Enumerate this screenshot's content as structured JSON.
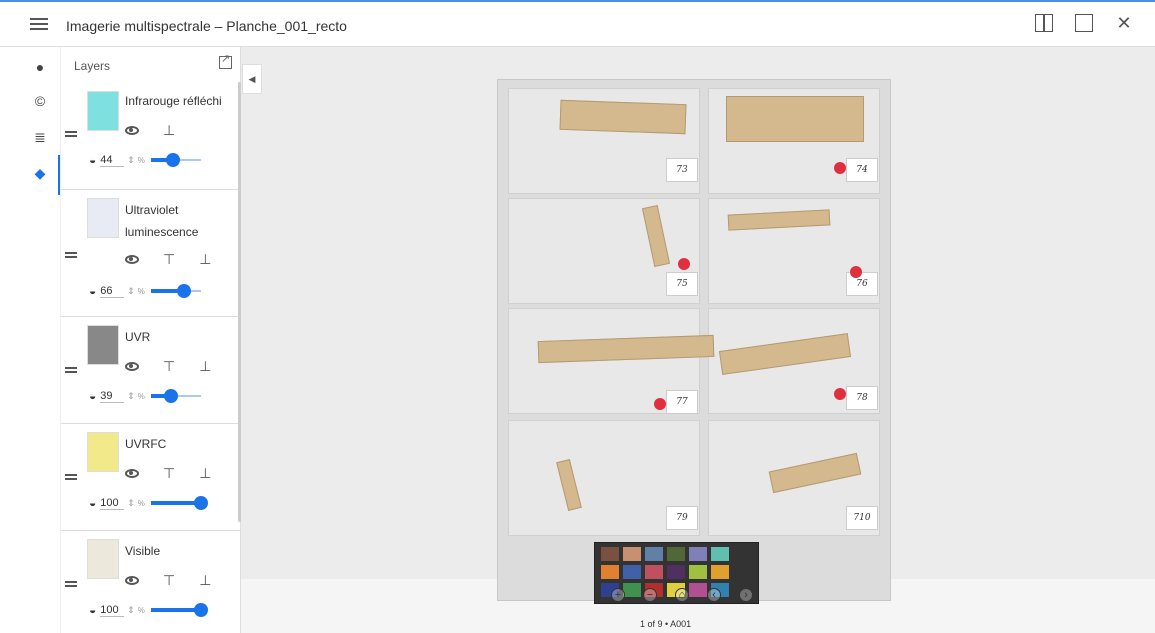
{
  "window": {
    "title": "Imagerie multispectrale – Planche_001_recto"
  },
  "panel": {
    "title": "Layers"
  },
  "layers": [
    {
      "name_line1": "Infrarouge réfléchi",
      "name_line2": "",
      "opacity": "44",
      "pct": "%",
      "level": 0.44,
      "thumb_color": "#7fe0e0"
    },
    {
      "name_line1": "Ultraviolet",
      "name_line2": "luminescence",
      "opacity": "66",
      "pct": "%",
      "level": 0.66,
      "thumb_color": "#e8eaf4"
    },
    {
      "name_line1": "UVR",
      "name_line2": "",
      "opacity": "39",
      "pct": "%",
      "level": 0.39,
      "thumb_color": "#888888"
    },
    {
      "name_line1": "UVRFC",
      "name_line2": "",
      "opacity": "100",
      "pct": "%",
      "level": 1.0,
      "thumb_color": "#f2e98a"
    },
    {
      "name_line1": "Visible",
      "name_line2": "",
      "opacity": "100",
      "pct": "%",
      "level": 1.0,
      "thumb_color": "#ece8dc"
    }
  ],
  "plate": {
    "labels": [
      "73",
      "74",
      "75",
      "76",
      "77",
      "78",
      "79",
      "710"
    ]
  },
  "footer": {
    "page_info": "1 of 9 • A001"
  },
  "colors": {
    "accent": "#1a73e8",
    "dot": "#e03040"
  }
}
